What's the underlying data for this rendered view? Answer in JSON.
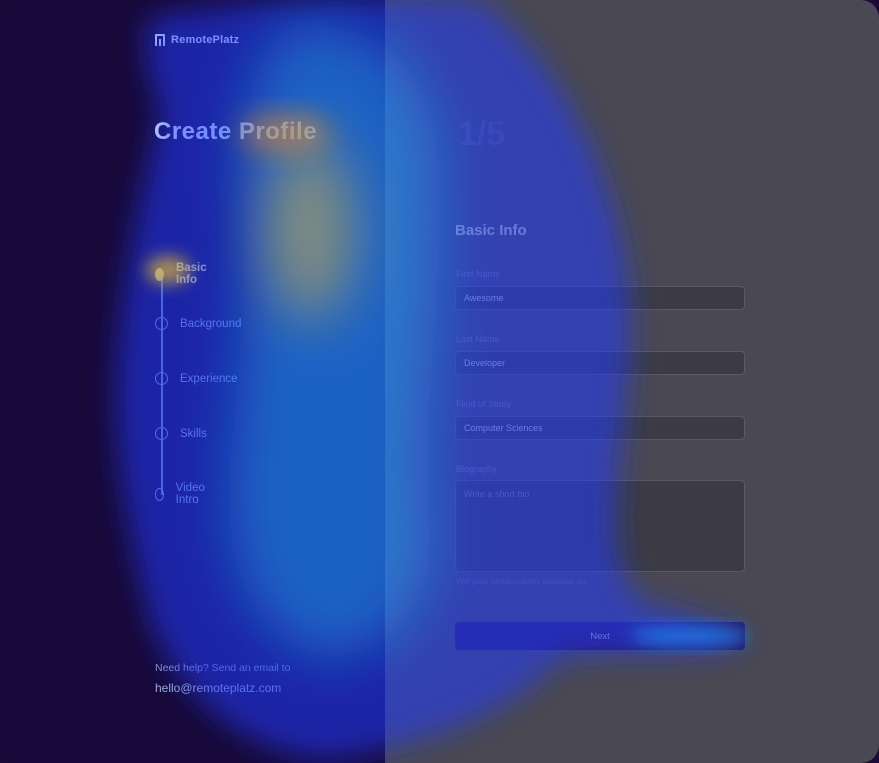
{
  "brand": {
    "name": "RemotePlatz"
  },
  "left": {
    "title": "Create Profile",
    "steps": [
      {
        "label": "Basic Info",
        "active": true
      },
      {
        "label": "Background",
        "active": false
      },
      {
        "label": "Experience",
        "active": false
      },
      {
        "label": "Skills",
        "active": false
      },
      {
        "label": "Video Intro",
        "active": false
      }
    ],
    "help_text": "Need help? Send an email to",
    "help_email": "hello@remoteplatz.com"
  },
  "right": {
    "progress": "1/5",
    "section_title": "Basic Info",
    "fields": [
      {
        "label": "First Name",
        "value": "Awesome"
      },
      {
        "label": "Last Name",
        "value": "Developer"
      },
      {
        "label": "Field of Study",
        "value": "Computer Sciences"
      }
    ],
    "biography": {
      "label": "Biography",
      "placeholder": "Write a short bio"
    },
    "hint": "Will your employability increase as",
    "next_label": "Next"
  },
  "colors": {
    "left_bg": "#18093a",
    "right_bg": "#4a4852",
    "active_step": "#ffe46a",
    "next_button": "#2b1a5c"
  }
}
